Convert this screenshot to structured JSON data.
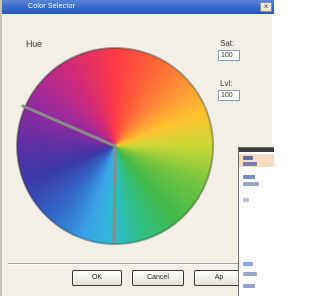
{
  "window": {
    "title": "Color Selector",
    "close_glyph": "×"
  },
  "hue": {
    "label": "Hue"
  },
  "fields": {
    "first": {
      "label": "Sat:",
      "value": "100"
    },
    "second": {
      "label": "Lvl:",
      "value": "100"
    }
  },
  "buttons": {
    "ok": "OK",
    "cancel": "Cancel",
    "third": "Ap"
  },
  "colors": {
    "title_bar": "#3366cc",
    "dialog_bg": "#f1efe6",
    "overlay_band": "#f4dcc4"
  },
  "icons": {
    "close": "close-icon",
    "hue_marker": "hue-marker-icon"
  }
}
